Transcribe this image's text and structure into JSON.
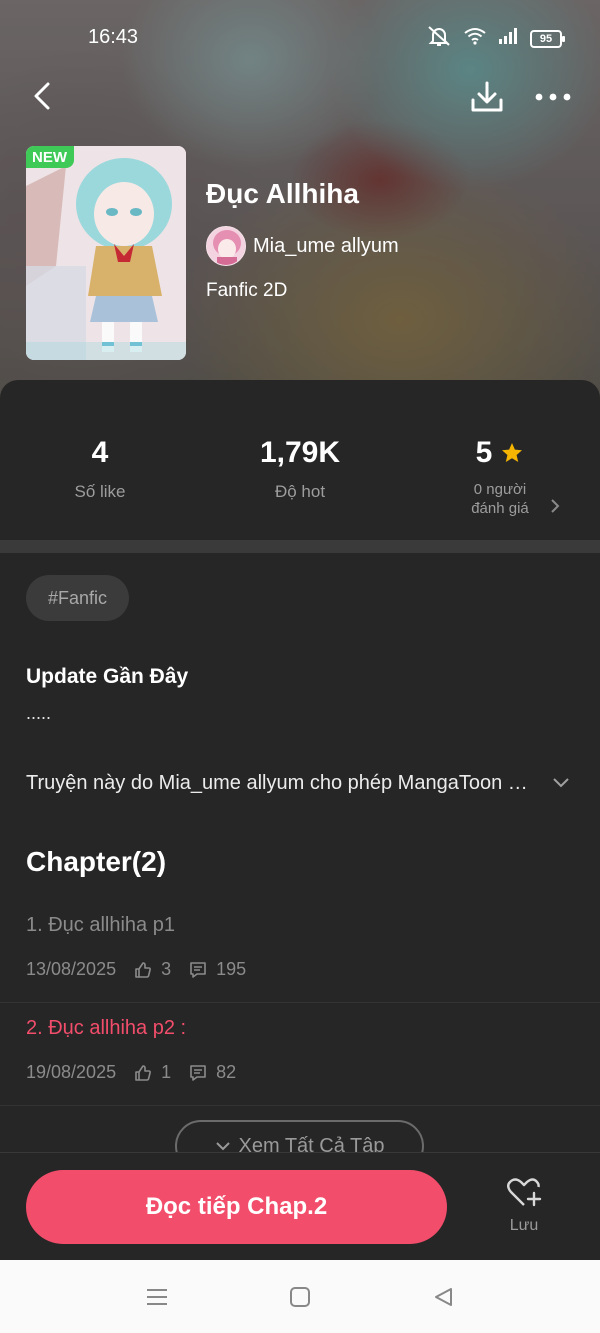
{
  "status_bar": {
    "time": "16:43",
    "battery": "95"
  },
  "hero": {
    "badge": "NEW",
    "title": "Đục Allhiha",
    "author": "Mia_ume allyum",
    "genre": "Fanfic 2D"
  },
  "stats": {
    "likes_value": "4",
    "likes_label": "Số like",
    "hot_value": "1,79K",
    "hot_label": "Độ hot",
    "rating_value": "5",
    "rating_count": "0 người",
    "rating_label": "đánh giá"
  },
  "tag": "#Fanfic",
  "update": {
    "title": "Update Gần Đây",
    "text": "....."
  },
  "description": "Truyện này do Mia_ume allyum cho phép MangaToon đăng tải",
  "chapters": {
    "title": "Chapter(2)",
    "items": [
      {
        "name": "1. Đục allhiha p1",
        "date": "13/08/2025",
        "likes": "3",
        "comments": "195"
      },
      {
        "name": "2. Đục allhiha p2 :",
        "date": "19/08/2025",
        "likes": "1",
        "comments": "82"
      }
    ],
    "view_all": "Xem Tất Cả Tập"
  },
  "actions": {
    "read_label": "Đọc tiếp Chap.2",
    "save_label": "Lưu"
  },
  "colors": {
    "accent": "#f24d6b",
    "background": "#262626",
    "badge_green": "#3fca57",
    "star": "#f5b400",
    "read_chapter": "#8b8b8b"
  },
  "icons": [
    "back-icon",
    "download-icon",
    "more-icon",
    "mute-icon",
    "wifi-icon",
    "signal-icon",
    "star-icon",
    "chevron-right-icon",
    "chevron-down-icon",
    "like-icon",
    "comment-icon",
    "heart-plus-icon",
    "menu-icon",
    "home-icon",
    "back-triangle-icon"
  ]
}
